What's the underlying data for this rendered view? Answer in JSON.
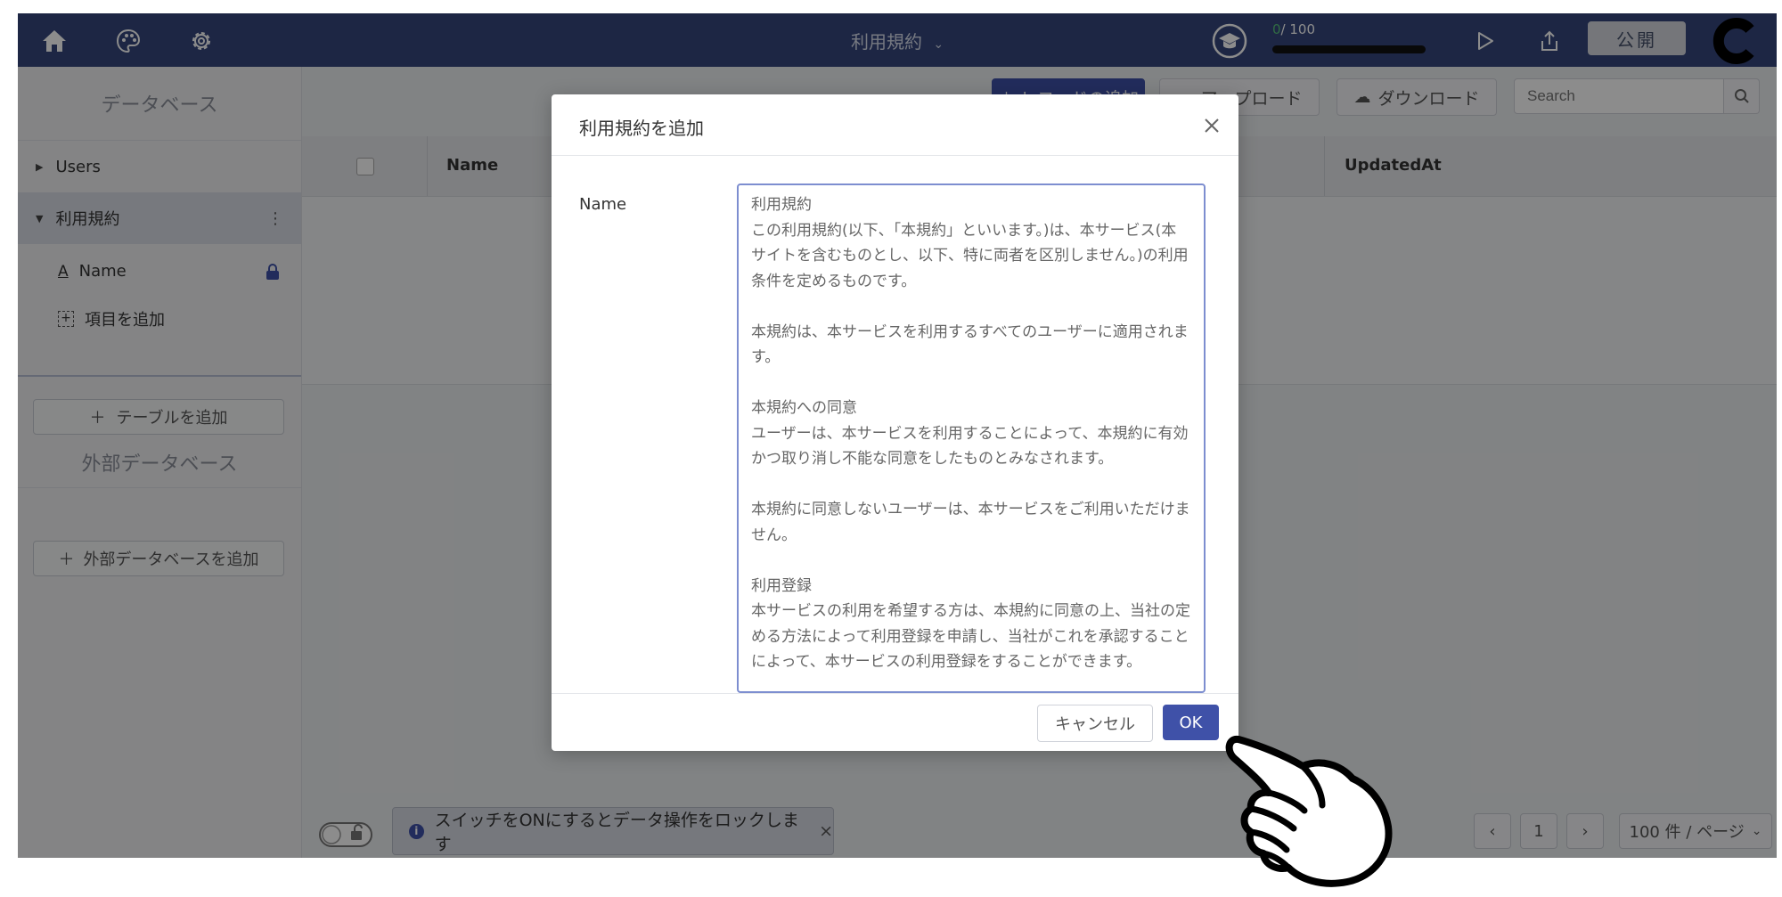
{
  "app": {
    "title": "利用規約",
    "progress": {
      "current": "0",
      "total": "/ 100",
      "fraction": 0
    },
    "publish_label": "公開"
  },
  "colors": {
    "header": "#35467c",
    "accent": "#3f51a8",
    "progress": "#58c47a"
  },
  "icons": {
    "header": [
      "home-icon",
      "palette-icon",
      "gear-icon",
      "graduation-cap-icon",
      "play-icon",
      "share-icon"
    ],
    "brand": "c-logo"
  },
  "sidebar": {
    "heading": "データベース",
    "tables": [
      {
        "label": "Users",
        "expanded": false
      },
      {
        "label": "利用規約",
        "expanded": true
      }
    ],
    "fields": [
      {
        "label": "Name",
        "locked": true
      }
    ],
    "add_field_label": "項目を追加",
    "add_table_label": "テーブルを追加",
    "external_heading": "外部データベース",
    "add_external_label": "外部データベースを追加"
  },
  "toolbar": {
    "add_record_label": "レコードの追加",
    "upload_label": "アップロード",
    "download_label": "ダウンロード",
    "search_placeholder": "Search"
  },
  "table": {
    "columns": [
      "Name",
      "UpdatedAt"
    ]
  },
  "footer": {
    "lock_notice": "スイッチをONにするとデータ操作をロックします",
    "page": "1",
    "per_page": "100 件 / ページ"
  },
  "dialog": {
    "title": "利用規約を追加",
    "field_label": "Name",
    "value": "利用規約\nこの利用規約(以下、「本規約」といいます。)は、本サービス(本サイトを含むものとし、以下、特に両者を区別しません。)の利用条件を定めるものです。\n\n本規約は、本サービスを利用するすべてのユーザーに適用されます。\n\n本規約への同意\nユーザーは、本サービスを利用することによって、本規約に有効かつ取り消し不能な同意をしたものとみなされます。\n\n本規約に同意しないユーザーは、本サービスをご利用いただけません。\n\n利用登録\n本サービスの利用を希望する方は、本規約に同意の上、当社の定める方法によって利用登録を申請し、当社がこれを承認することによって、本サービスの利用登録をすることができます。",
    "cancel_label": "キャンセル",
    "ok_label": "OK"
  }
}
